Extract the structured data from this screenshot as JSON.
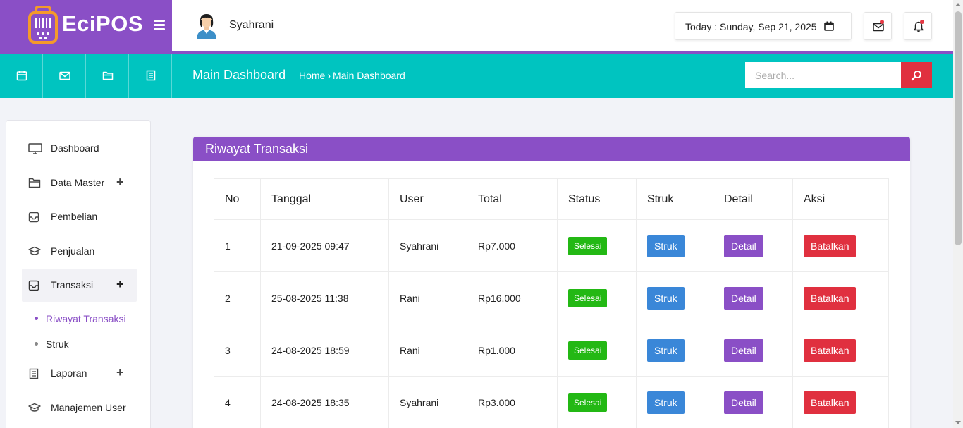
{
  "brand": {
    "name": "EciPOS"
  },
  "header": {
    "user_name": "Syahrani",
    "date_text": "Today : Sunday, Sep 21, 2025"
  },
  "toolbar": {
    "page_title": "Main Dashboard",
    "breadcrumb": {
      "home": "Home",
      "current": "Main Dashboard"
    },
    "search_placeholder": "Search..."
  },
  "sidebar": {
    "items": [
      {
        "label": "Dashboard",
        "icon": "monitor-icon"
      },
      {
        "label": "Data Master",
        "icon": "folder-icon",
        "expandable": true
      },
      {
        "label": "Pembelian",
        "icon": "inbox-icon"
      },
      {
        "label": "Penjualan",
        "icon": "graduation-cap-icon"
      },
      {
        "label": "Transaksi",
        "icon": "inbox-icon",
        "expandable": true,
        "active": true
      },
      {
        "label": "Laporan",
        "icon": "document-icon",
        "expandable": true
      },
      {
        "label": "Manajemen User",
        "icon": "graduation-cap-icon"
      }
    ],
    "plus": "+",
    "sub_items": [
      {
        "label": "Riwayat Transaksi",
        "active": true
      },
      {
        "label": "Struk"
      }
    ]
  },
  "card": {
    "title": "Riwayat Transaksi",
    "columns": [
      "No",
      "Tanggal",
      "User",
      "Total",
      "Status",
      "Struk",
      "Detail",
      "Aksi"
    ],
    "rows": [
      {
        "no": "1",
        "tanggal": "21-09-2025 09:47",
        "user": "Syahrani",
        "total": "Rp7.000",
        "status": "Selesai",
        "struk": "Struk",
        "detail": "Detail",
        "aksi": "Batalkan"
      },
      {
        "no": "2",
        "tanggal": "25-08-2025 11:38",
        "user": "Rani",
        "total": "Rp16.000",
        "status": "Selesai",
        "struk": "Struk",
        "detail": "Detail",
        "aksi": "Batalkan"
      },
      {
        "no": "3",
        "tanggal": "24-08-2025 18:59",
        "user": "Rani",
        "total": "Rp1.000",
        "status": "Selesai",
        "struk": "Struk",
        "detail": "Detail",
        "aksi": "Batalkan"
      },
      {
        "no": "4",
        "tanggal": "24-08-2025 18:35",
        "user": "Syahrani",
        "total": "Rp3.000",
        "status": "Selesai",
        "struk": "Struk",
        "detail": "Detail",
        "aksi": "Batalkan"
      }
    ]
  },
  "colors": {
    "brand_purple": "#8a4fc6",
    "teal": "#00c4c0",
    "danger": "#e0303f",
    "success": "#23b814",
    "info": "#3a87d8"
  },
  "icons": {
    "header": [
      "calendar-icon",
      "mail-icon",
      "bell-icon"
    ],
    "toolbar": [
      "calendar-icon",
      "mail-icon",
      "folder-icon",
      "document-icon",
      "search-icon"
    ]
  }
}
